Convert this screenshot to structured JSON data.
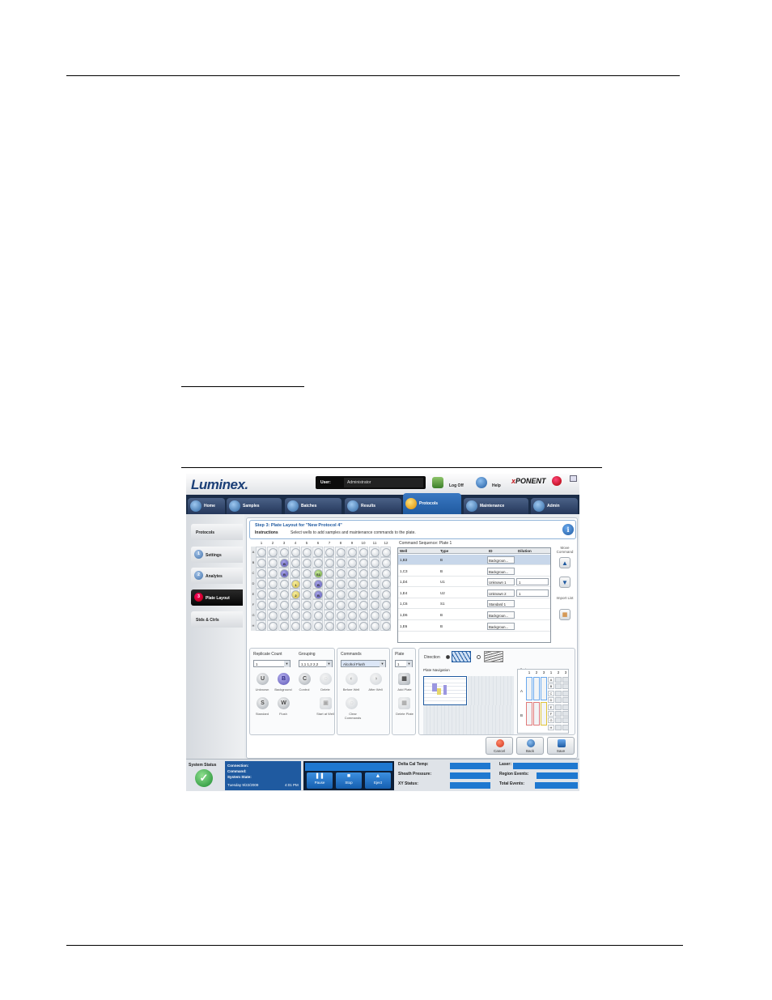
{
  "app": {
    "logo": "Luminex.",
    "user_label": "User:",
    "user_value": "Administrator",
    "logoff_label": "Log Off",
    "help_label": "Help",
    "brand_x": "x",
    "brand_rest": "PONENT"
  },
  "nav": {
    "tabs": [
      {
        "label": "Home"
      },
      {
        "label": "Samples"
      },
      {
        "label": "Batches"
      },
      {
        "label": "Results"
      },
      {
        "label": "Protocols",
        "active": true
      },
      {
        "label": "Maintenance"
      },
      {
        "label": "Admin"
      }
    ]
  },
  "sidebar": {
    "header": "Protocols",
    "items": [
      {
        "num": "1",
        "label": "Settings"
      },
      {
        "num": "2",
        "label": "Analytes"
      },
      {
        "num": "3",
        "label": "Plate Layout",
        "active": true
      },
      {
        "num": "",
        "label": "Stds & Ctrls"
      }
    ]
  },
  "step": {
    "title": "Step 3: Plate Layout for \"New Protocol 4\"",
    "instructions_label": "Instructions",
    "instructions_text": "Select wells to add samples and maintenance commands to the plate."
  },
  "plate": {
    "columns": [
      "1",
      "2",
      "3",
      "4",
      "5",
      "6",
      "7",
      "8",
      "9",
      "10",
      "11",
      "12"
    ],
    "rows": [
      "A",
      "B",
      "C",
      "D",
      "E",
      "F",
      "G",
      "H"
    ]
  },
  "command_sequence": {
    "title": "Command Sequence: Plate 1",
    "headers": [
      "Well",
      "Type",
      "ID",
      "Dilution"
    ],
    "rows": [
      {
        "well": "1,B3",
        "type": "B",
        "id": "Backgroun...",
        "dilution": ""
      },
      {
        "well": "1,C3",
        "type": "B",
        "id": "Backgroun...",
        "dilution": ""
      },
      {
        "well": "1,D4",
        "type": "U1",
        "id": "Unknown 1",
        "dilution": "1"
      },
      {
        "well": "1,E4",
        "type": "U2",
        "id": "Unknown 2",
        "dilution": "1"
      },
      {
        "well": "1,C6",
        "type": "S1",
        "id": "Standard 1",
        "dilution": ""
      },
      {
        "well": "1,D6",
        "type": "B",
        "id": "Backgroun...",
        "dilution": ""
      },
      {
        "well": "1,E6",
        "type": "B",
        "id": "Backgroun...",
        "dilution": ""
      }
    ],
    "move_label": "Move Command",
    "import_label": "Import List"
  },
  "controls": {
    "replicate_label": "Replicate Count",
    "replicate_value": "1",
    "grouping_label": "Grouping",
    "grouping_value": "1,1 1,2 2,2",
    "sample_buttons": [
      {
        "letter": "U",
        "label": "Unknown"
      },
      {
        "letter": "B",
        "label": "Background"
      },
      {
        "letter": "C",
        "label": "Control"
      },
      {
        "letter": "",
        "label": "Delete"
      },
      {
        "letter": "S",
        "label": "Standard"
      },
      {
        "letter": "W",
        "label": "Flush"
      },
      {
        "letter": "",
        "label": "Start at Well"
      }
    ],
    "commands_label": "Commands",
    "commands_value": "Alcohol Flush",
    "command_buttons": [
      {
        "label": "Before Well"
      },
      {
        "label": "After Well"
      },
      {
        "label": "Clear Commands"
      }
    ],
    "plate_label": "Plate",
    "plate_value": "1",
    "add_plate_label": "Add Plate",
    "delete_plate_label": "Delete Plate",
    "direction_label": "Direction",
    "plate_nav_label": "Plate Navigation",
    "off_plate_label": "Off Plate Area",
    "off_plate_cols": [
      "1",
      "2",
      "3",
      "1",
      "2",
      "3"
    ],
    "off_plate_rows": [
      "A",
      "B",
      "C",
      "D",
      "E",
      "F",
      "G",
      "H"
    ],
    "off_plate_reservoirs": [
      "A",
      "B"
    ]
  },
  "footer": {
    "cancel": "Cancel",
    "back": "Back",
    "save": "Save"
  },
  "status": {
    "title": "System Status",
    "connection": "Connection:",
    "command": "Command:",
    "system_state": "System State:",
    "date": "Tuesday 9/22/2009",
    "time": "4:01 PM",
    "pause": "Pause",
    "stop": "Stop",
    "eject": "Eject",
    "metrics": [
      "Delta Cal Temp:",
      "Sheath Pressure:",
      "XY Status:",
      "Laser:",
      "Region Events:",
      "Total Events:"
    ]
  }
}
